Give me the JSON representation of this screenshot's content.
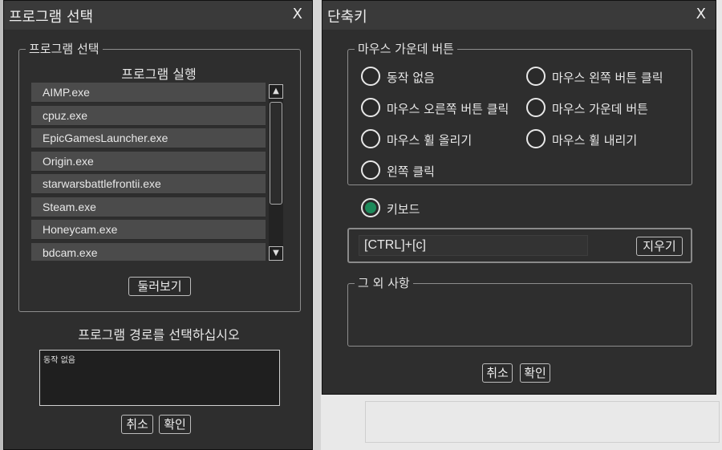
{
  "left_dialog": {
    "title": "프로그램 선택",
    "close": "X",
    "group_legend": "프로그램 선택",
    "run_label": "프로그램 실행",
    "programs": [
      "AIMP.exe",
      "cpuz.exe",
      "EpicGamesLauncher.exe",
      "Origin.exe",
      "starwarsbattlefrontii.exe",
      "Steam.exe",
      "Honeycam.exe",
      "bdcam.exe"
    ],
    "scroll_up": "▲",
    "scroll_down": "▼",
    "browse_button": "둘러보기",
    "path_prompt": "프로그램 경로를 선택하십시오",
    "path_value": "동작 없음",
    "cancel": "취소",
    "ok": "확인"
  },
  "right_dialog": {
    "title": "단축키",
    "close": "X",
    "mouse_group_legend": "마우스 가운데 버튼",
    "mouse_options": [
      "동작 없음",
      "마우스 왼쪽 버튼 클릭",
      "마우스 오른쪽 버튼 클릭",
      "마우스 가운데 버튼",
      "마우스 휠 올리기",
      "마우스 휠 내리기",
      "왼쪽 클릭"
    ],
    "keyboard_label": "키보드",
    "key_value": "[CTRL]+[c]",
    "clear_button": "지우기",
    "other_legend": "그 외 사항",
    "cancel": "취소",
    "ok": "확인",
    "selected_option": "키보드",
    "accent_color": "#1c8a5a"
  }
}
